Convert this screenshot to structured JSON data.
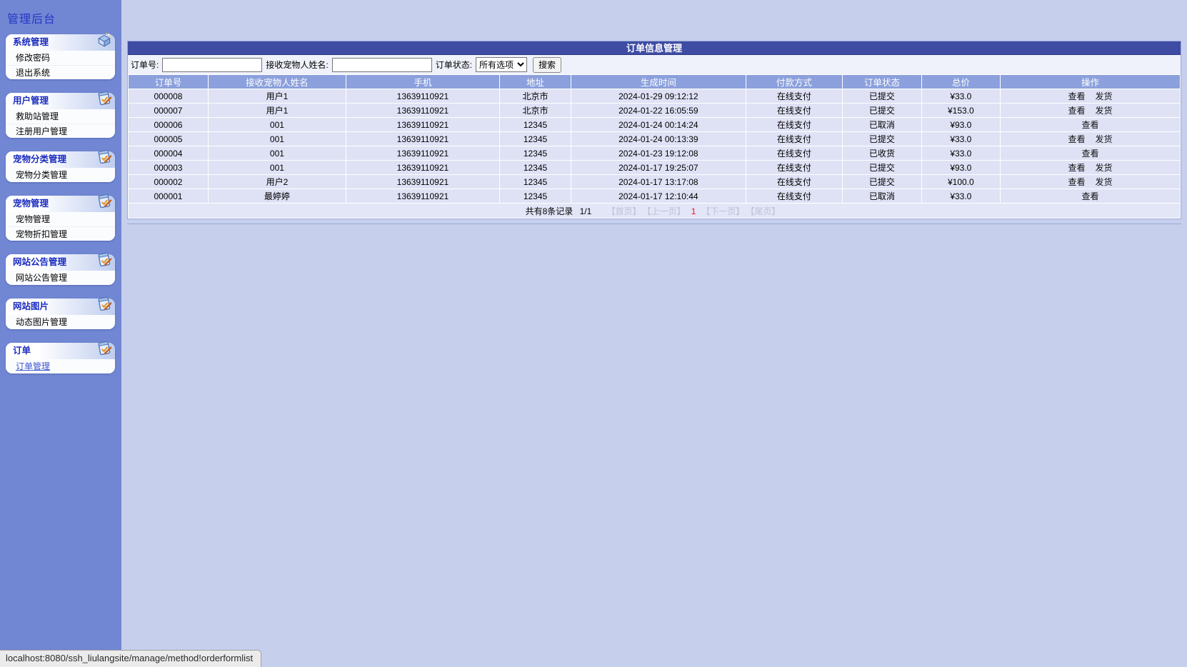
{
  "window": {
    "status_url": "localhost:8080/ssh_liulangsite/manage/method!orderformlist"
  },
  "colors": {
    "sidebar_bg": "#7187d3",
    "page_bg": "#c6cfec",
    "titlebar_bg": "#3e4ca4",
    "table_header_bg": "#8ba0dc",
    "row_bg": "#dfe2f5",
    "current_page_red": "#ff1010",
    "menu_title_blue": "#1b2cc0"
  },
  "icons": {
    "system_panel": "system-tools-icon",
    "other_panels": "clipboard-edit-icon"
  },
  "sidebar": {
    "brand": "管理后台",
    "panels": [
      {
        "title": "系统管理",
        "items": [
          {
            "label": "修改密码"
          },
          {
            "label": "退出系统"
          }
        ]
      },
      {
        "title": "用户管理",
        "items": [
          {
            "label": "救助站管理"
          },
          {
            "label": "注册用户管理"
          }
        ]
      },
      {
        "title": "宠物分类管理",
        "items": [
          {
            "label": "宠物分类管理"
          }
        ]
      },
      {
        "title": "宠物管理",
        "items": [
          {
            "label": "宠物管理"
          },
          {
            "label": "宠物折扣管理"
          }
        ]
      },
      {
        "title": "网站公告管理",
        "items": [
          {
            "label": "网站公告管理"
          }
        ]
      },
      {
        "title": "网站图片",
        "items": [
          {
            "label": "动态图片管理"
          }
        ]
      },
      {
        "title": "订单",
        "items": [
          {
            "label": "订单管理",
            "active": true
          }
        ]
      }
    ]
  },
  "main": {
    "title": "订单信息管理",
    "search": {
      "order_no_label": "订单号:",
      "receiver_label": "接收宠物人姓名:",
      "status_label": "订单状态:",
      "status_selected": "所有选项",
      "search_button": "搜索"
    },
    "table": {
      "columns": [
        "订单号",
        "接收宠物人姓名",
        "手机",
        "地址",
        "生成时间",
        "付款方式",
        "订单状态",
        "总价",
        "操作"
      ],
      "rows": [
        {
          "order_no": "000008",
          "receiver": "用户1",
          "phone": "13639110921",
          "address": "北京市",
          "created": "2024-01-29 09:12:12",
          "payment": "在线支付",
          "status": "已提交",
          "total": "¥33.0",
          "actions": [
            "查看",
            "发货"
          ]
        },
        {
          "order_no": "000007",
          "receiver": "用户1",
          "phone": "13639110921",
          "address": "北京市",
          "created": "2024-01-22 16:05:59",
          "payment": "在线支付",
          "status": "已提交",
          "total": "¥153.0",
          "actions": [
            "查看",
            "发货"
          ]
        },
        {
          "order_no": "000006",
          "receiver": "001",
          "phone": "13639110921",
          "address": "12345",
          "created": "2024-01-24 00:14:24",
          "payment": "在线支付",
          "status": "已取消",
          "total": "¥93.0",
          "actions": [
            "查看"
          ]
        },
        {
          "order_no": "000005",
          "receiver": "001",
          "phone": "13639110921",
          "address": "12345",
          "created": "2024-01-24 00:13:39",
          "payment": "在线支付",
          "status": "已提交",
          "total": "¥33.0",
          "actions": [
            "查看",
            "发货"
          ]
        },
        {
          "order_no": "000004",
          "receiver": "001",
          "phone": "13639110921",
          "address": "12345",
          "created": "2024-01-23 19:12:08",
          "payment": "在线支付",
          "status": "已收货",
          "total": "¥33.0",
          "actions": [
            "查看"
          ]
        },
        {
          "order_no": "000003",
          "receiver": "001",
          "phone": "13639110921",
          "address": "12345",
          "created": "2024-01-17 19:25:07",
          "payment": "在线支付",
          "status": "已提交",
          "total": "¥93.0",
          "actions": [
            "查看",
            "发货"
          ]
        },
        {
          "order_no": "000002",
          "receiver": "用户2",
          "phone": "13639110921",
          "address": "12345",
          "created": "2024-01-17 13:17:08",
          "payment": "在线支付",
          "status": "已提交",
          "total": "¥100.0",
          "actions": [
            "查看",
            "发货"
          ]
        },
        {
          "order_no": "000001",
          "receiver": "最婷婷",
          "phone": "13639110921",
          "address": "12345",
          "created": "2024-01-17 12:10:44",
          "payment": "在线支付",
          "status": "已取消",
          "total": "¥33.0",
          "actions": [
            "查看"
          ]
        }
      ]
    },
    "pagination": {
      "summary": "共有8条记录",
      "page_indicator": "1/1",
      "links": [
        {
          "label": "【首页】",
          "state": "disabled"
        },
        {
          "label": "【上一页】",
          "state": "disabled"
        },
        {
          "label": "1",
          "state": "current"
        },
        {
          "label": "【下一页】",
          "state": "disabled"
        },
        {
          "label": "【尾页】",
          "state": "disabled"
        }
      ]
    }
  }
}
